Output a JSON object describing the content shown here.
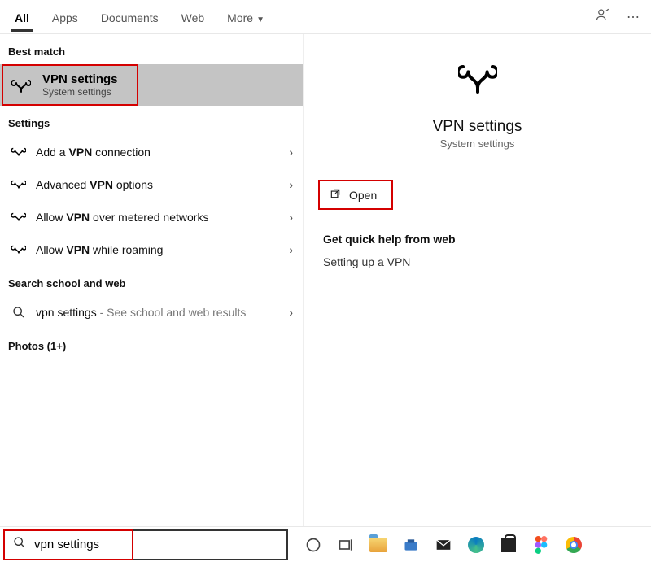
{
  "tabs": {
    "all": "All",
    "apps": "Apps",
    "documents": "Documents",
    "web": "Web",
    "more": "More"
  },
  "sections": {
    "best_match": "Best match",
    "settings": "Settings",
    "search_web": "Search school and web",
    "photos": "Photos (1+)"
  },
  "best_match": {
    "title": "VPN settings",
    "sub": "System settings"
  },
  "settings_items": {
    "add_pre": "Add a ",
    "add_em": "VPN",
    "add_post": " connection",
    "adv_pre": "Advanced ",
    "adv_em": "VPN",
    "adv_post": " options",
    "metered_pre": "Allow ",
    "metered_em": "VPN",
    "metered_post": " over metered networks",
    "roam_pre": "Allow ",
    "roam_em": "VPN",
    "roam_post": " while roaming"
  },
  "web_item": {
    "term": "vpn settings",
    "hint": " - See school and web results"
  },
  "preview": {
    "title": "VPN settings",
    "sub": "System settings",
    "open": "Open"
  },
  "quick_help": {
    "header": "Get quick help from web",
    "link1": "Setting up a VPN"
  },
  "search": {
    "value": "vpn settings"
  }
}
